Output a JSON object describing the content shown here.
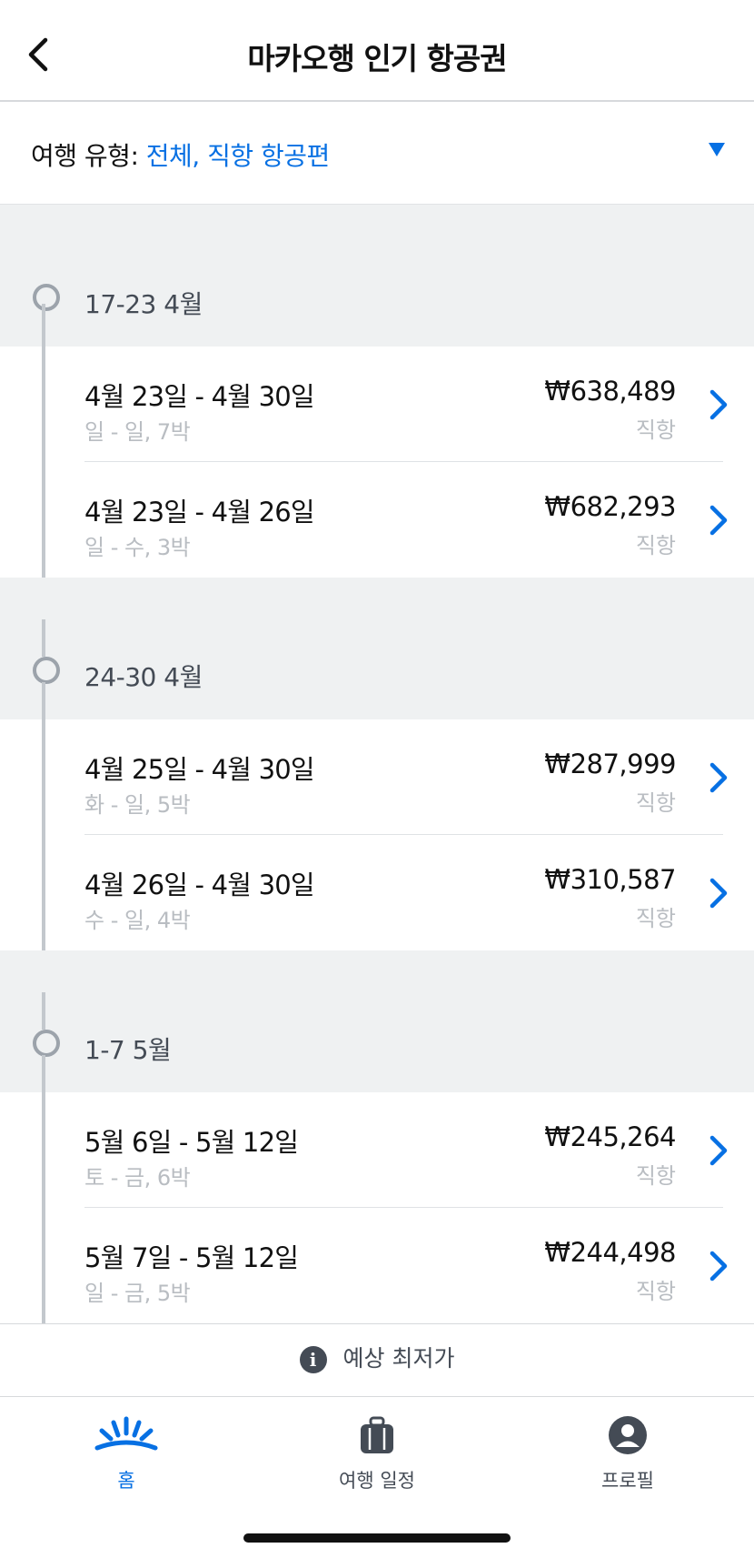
{
  "header": {
    "title": "마카오행 인기 항공권"
  },
  "filter": {
    "label": "여행 유형: ",
    "value": "전체, 직항 항공편"
  },
  "weeks": [
    {
      "label": "17-23 4월",
      "trips": [
        {
          "dates": "4월 23일 - 4월 30일",
          "days": "일 - 일, 7박",
          "price": "₩638,489",
          "type": "직항"
        },
        {
          "dates": "4월 23일 - 4월 26일",
          "days": "일 - 수, 3박",
          "price": "₩682,293",
          "type": "직항"
        }
      ]
    },
    {
      "label": "24-30 4월",
      "trips": [
        {
          "dates": "4월 25일 - 4월 30일",
          "days": "화 - 일, 5박",
          "price": "₩287,999",
          "type": "직항"
        },
        {
          "dates": "4월 26일 - 4월 30일",
          "days": "수 - 일, 4박",
          "price": "₩310,587",
          "type": "직항"
        }
      ]
    },
    {
      "label": "1-7 5월",
      "trips": [
        {
          "dates": "5월 6일 - 5월 12일",
          "days": "토 - 금, 6박",
          "price": "₩245,264",
          "type": "직항"
        },
        {
          "dates": "5월 7일 - 5월 12일",
          "days": "일 - 금, 5박",
          "price": "₩244,498",
          "type": "직항"
        }
      ]
    }
  ],
  "info": {
    "text": "예상 최저가",
    "icon": "info-icon"
  },
  "tabs": [
    {
      "label": "홈",
      "icon": "home-sunrise-icon",
      "active": true
    },
    {
      "label": "여행 일정",
      "icon": "luggage-icon",
      "active": false
    },
    {
      "label": "프로필",
      "icon": "profile-icon",
      "active": false
    }
  ],
  "colors": {
    "accent": "#0770e3",
    "background": "#eff1f2",
    "muted": "#b9bdc2"
  }
}
